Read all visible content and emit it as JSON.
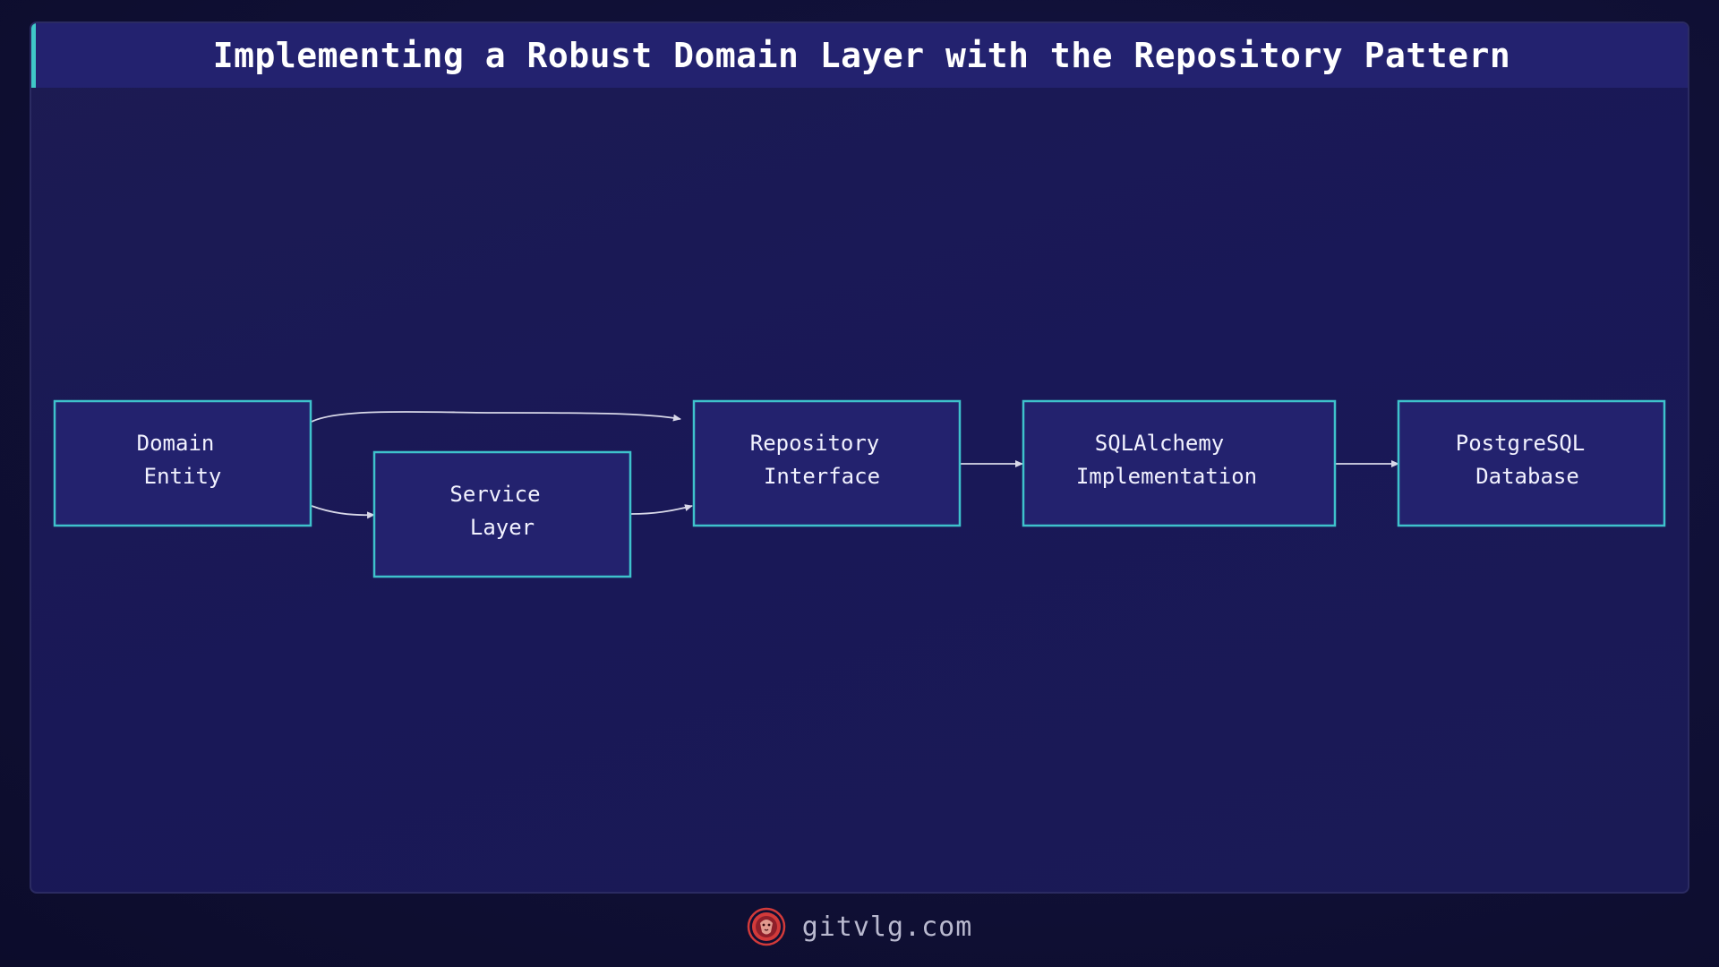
{
  "title": "Implementing a Robust Domain Layer with the Repository Pattern",
  "nodes": [
    {
      "id": "domain-entity",
      "lines": [
        "Domain",
        "Entity"
      ]
    },
    {
      "id": "service-layer",
      "lines": [
        "Service",
        "Layer"
      ]
    },
    {
      "id": "repository-interface",
      "lines": [
        "Repository",
        "Interface"
      ]
    },
    {
      "id": "sqlalchemy-implementation",
      "lines": [
        "SQLAlchemy",
        "Implementation"
      ]
    },
    {
      "id": "postgresql-database",
      "lines": [
        "PostgreSQL",
        "Database"
      ]
    }
  ],
  "edges": [
    {
      "from": "domain-entity",
      "to": "repository-interface"
    },
    {
      "from": "domain-entity",
      "to": "service-layer"
    },
    {
      "from": "service-layer",
      "to": "repository-interface"
    },
    {
      "from": "repository-interface",
      "to": "sqlalchemy-implementation"
    },
    {
      "from": "sqlalchemy-implementation",
      "to": "postgresql-database"
    }
  ],
  "footer": {
    "site": "gitvlg.com",
    "logo_icon": "lion-logo-icon",
    "logo_color": "#d23a3a"
  },
  "colors": {
    "accent": "#3ec2cc",
    "node_fill": "#23226e",
    "title_bar": "#23226f"
  }
}
